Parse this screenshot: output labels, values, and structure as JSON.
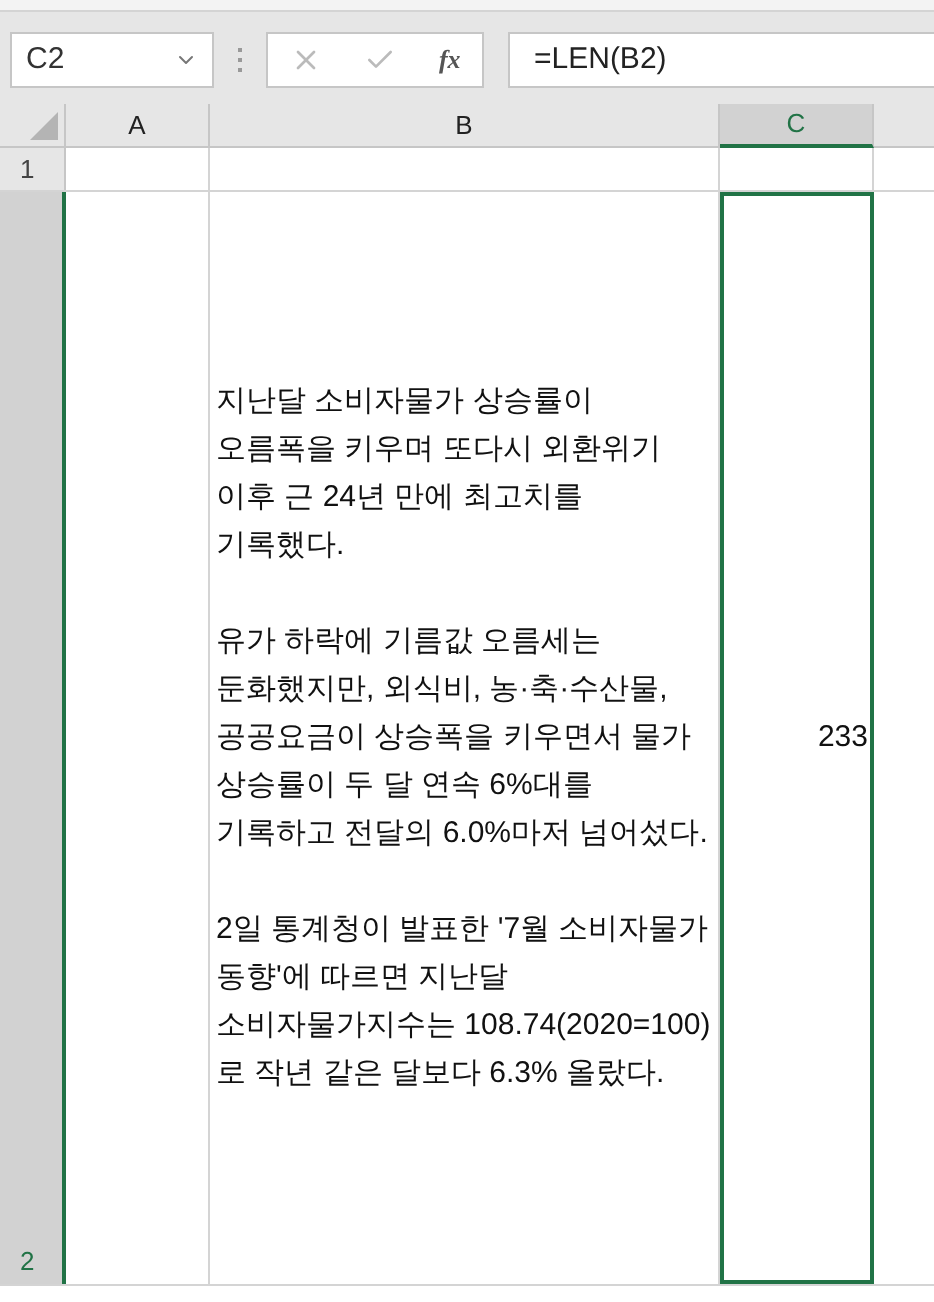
{
  "name_box": {
    "value": "C2"
  },
  "formula_bar": {
    "function_label": "fx",
    "value": "=LEN(B2)"
  },
  "columns": [
    {
      "label": "A",
      "selected": false
    },
    {
      "label": "B",
      "selected": false
    },
    {
      "label": "C",
      "selected": true
    }
  ],
  "rows": [
    {
      "label": "1",
      "selected": false
    },
    {
      "label": "2",
      "selected": true,
      "b": {
        "value": "지난달 소비자물가 상승률이 오름폭을 키우며 또다시 외환위기 이후 근 24년 만에 최고치를 기록했다.\n\n유가 하락에 기름값 오름세는 둔화했지만, 외식비, 농·축·수산물, 공공요금이 상승폭을 키우면서 물가 상승률이 두 달 연속 6%대를 기록하고 전달의 6.0%마저 넘어섰다.\n\n2일 통계청이 발표한 '7월 소비자물가 동향'에 따르면 지난달 소비자물가지수는 108.74(2020=100)로 작년 같은 달보다 6.3% 올랐다."
      },
      "c": {
        "value": "233",
        "selected": true
      }
    }
  ]
}
